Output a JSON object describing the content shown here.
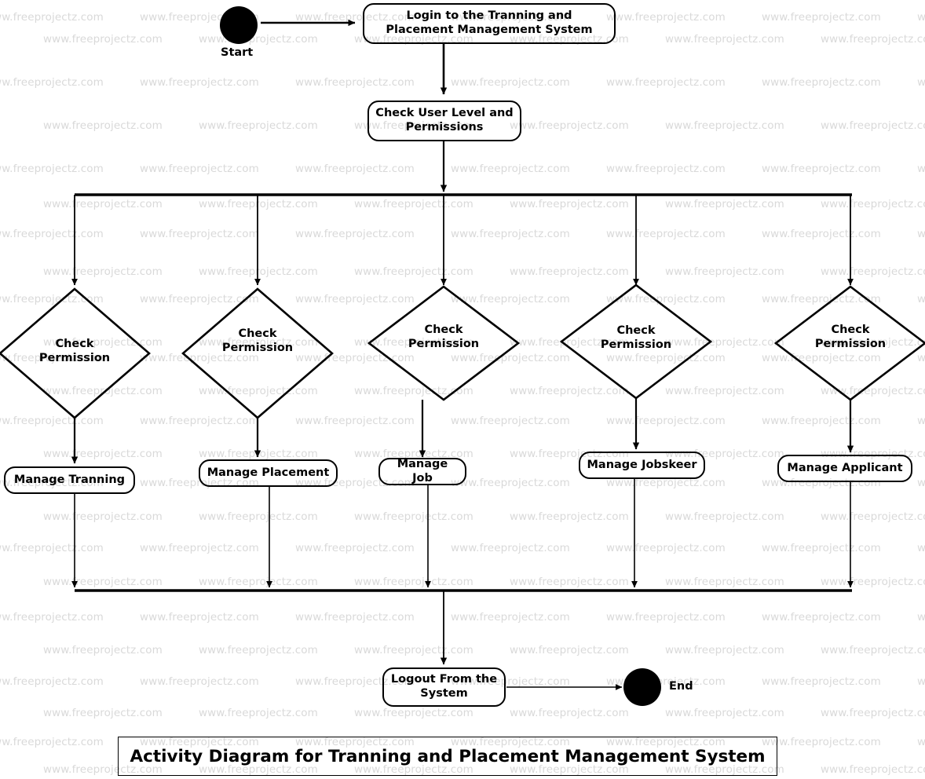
{
  "diagram": {
    "title": "Activity Diagram for Tranning and Placement Management System",
    "watermark_text": "www.freeprojectz.com",
    "colors": {
      "stroke": "#000000",
      "fill": "#ffffff",
      "watermark": "#d9d9d9"
    }
  },
  "nodes": {
    "start": {
      "label": "Start",
      "type": "initial-node"
    },
    "login": {
      "label": "Login to the Tranning and Placement Management System",
      "type": "activity"
    },
    "check_user_level": {
      "label": "Check User Level and Permissions",
      "type": "activity"
    },
    "decisions": [
      {
        "label": "Check Permission",
        "line1": "Check",
        "line2": "Permission"
      },
      {
        "label": "Check Permission",
        "line1": "Check",
        "line2": "Permission"
      },
      {
        "label": "Check Permission",
        "line1": "Check",
        "line2": "Permission"
      },
      {
        "label": "Check Permission",
        "line1": "Check",
        "line2": "Permission"
      },
      {
        "label": "Check Permission",
        "line1": "Check",
        "line2": "Permission"
      }
    ],
    "actions": [
      {
        "label": "Manage Tranning"
      },
      {
        "label": "Manage Placement"
      },
      {
        "label": "Manage Job"
      },
      {
        "label": "Manage Jobskeer"
      },
      {
        "label": "Manage Applicant"
      }
    ],
    "logout": {
      "label": "Logout From the System",
      "type": "activity"
    },
    "end": {
      "label": "End",
      "type": "final-node"
    }
  }
}
